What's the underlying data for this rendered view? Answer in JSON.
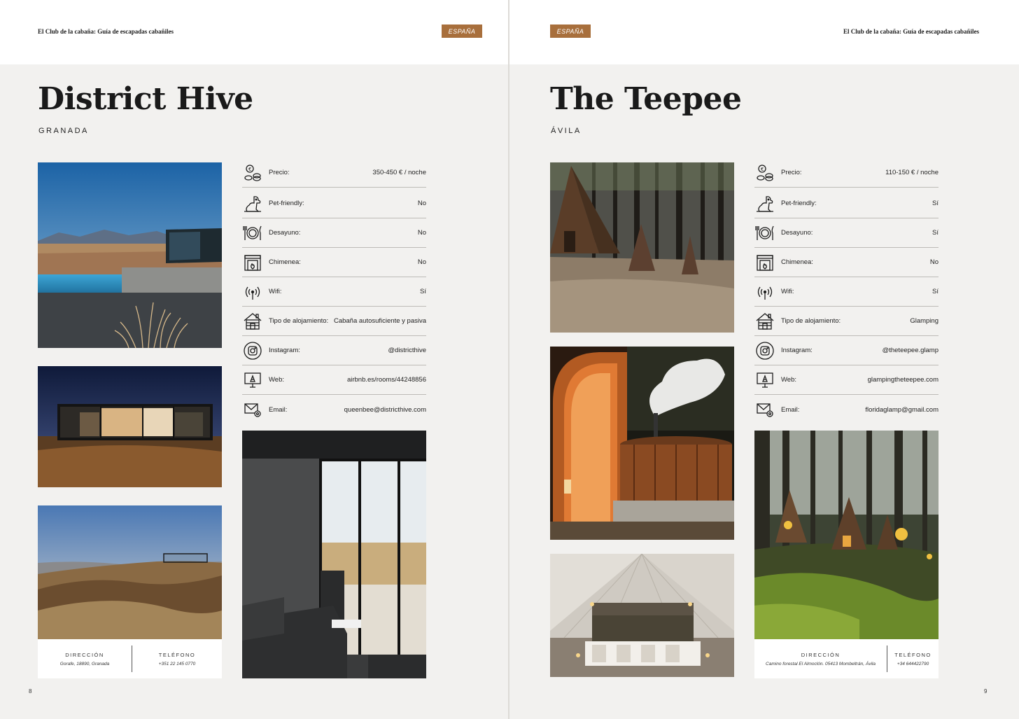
{
  "left_page": {
    "guide_title": "El Club de la cabaña: Guía de escapadas cabañiles",
    "badge": "ESPAÑA",
    "title": "District Hive",
    "city": "GRANADA",
    "info": [
      {
        "icon": "coins-icon",
        "label": "Precio:",
        "value": "350-450 € / noche"
      },
      {
        "icon": "pet-icon",
        "label": "Pet-friendly:",
        "value": "No"
      },
      {
        "icon": "plate-cutlery-icon",
        "label": "Desayuno:",
        "value": "No"
      },
      {
        "icon": "fireplace-icon",
        "label": "Chimenea:",
        "value": "No"
      },
      {
        "icon": "wifi-icon",
        "label": "Wifi:",
        "value": "Sí"
      },
      {
        "icon": "cabin-icon",
        "label": "Tipo de alojamiento:",
        "value": "Cabaña autosuficiente y pasiva"
      },
      {
        "icon": "instagram-icon",
        "label": "Instagram:",
        "value": "@districthive"
      },
      {
        "icon": "monitor-icon",
        "label": "Web:",
        "value": "airbnb.es/rooms/44248856"
      },
      {
        "icon": "email-icon",
        "label": "Email:",
        "value": "queenbee@districthive.com"
      }
    ],
    "contact": {
      "address_heading": "DIRECCIÓN",
      "address": "Gorafe, 18890, Granada",
      "phone_heading": "TELÉFONO",
      "phone": "+351 22 145 0770"
    },
    "page_number": "8"
  },
  "right_page": {
    "guide_title": "El Club de la cabaña: Guía de escapadas cabañiles",
    "badge": "ESPAÑA",
    "title": "The Teepee",
    "city": "ÁVILA",
    "info": [
      {
        "icon": "coins-icon",
        "label": "Precio:",
        "value": "110-150 € / noche"
      },
      {
        "icon": "pet-icon",
        "label": "Pet-friendly:",
        "value": "Sí"
      },
      {
        "icon": "plate-cutlery-icon",
        "label": "Desayuno:",
        "value": "Sí"
      },
      {
        "icon": "fireplace-icon",
        "label": "Chimenea:",
        "value": "No"
      },
      {
        "icon": "wifi-icon",
        "label": "Wifi:",
        "value": "Sí"
      },
      {
        "icon": "cabin-icon",
        "label": "Tipo de alojamiento:",
        "value": "Glamping"
      },
      {
        "icon": "instagram-icon",
        "label": "Instagram:",
        "value": "@theteepee.glamp"
      },
      {
        "icon": "monitor-icon",
        "label": "Web:",
        "value": "glampingtheteepee.com"
      },
      {
        "icon": "email-icon",
        "label": "Email:",
        "value": "floridaglamp@gmail.com"
      }
    ],
    "contact": {
      "address_heading": "DIRECCIÓN",
      "address": "Camino forestal El Almoclón. 05413 Mombeltrán, Ávila",
      "phone_heading": "TELÉFONO",
      "phone": "+34 644422790"
    },
    "page_number": "9"
  },
  "colors": {
    "badge": "#a86f3c",
    "page_background": "#f2f1ef",
    "header_background": "#ffffff",
    "text": "#1c1c1c"
  }
}
